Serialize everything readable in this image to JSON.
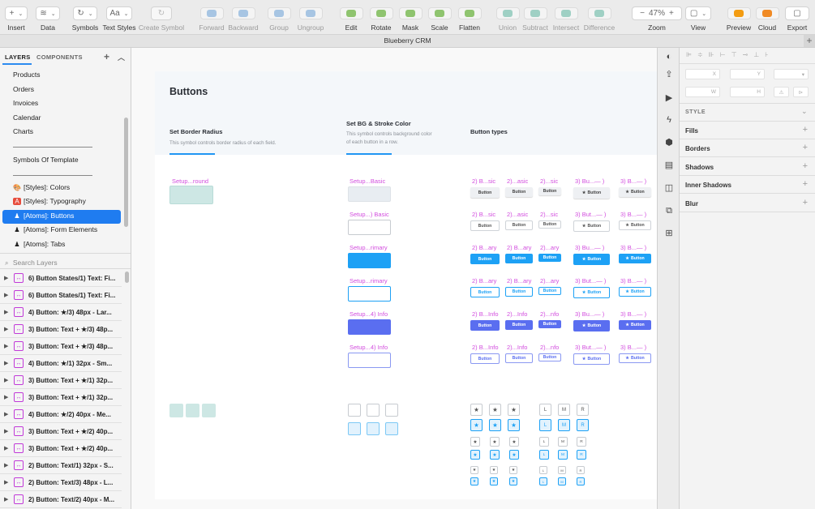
{
  "toolbar": {
    "items": [
      {
        "key": "insert",
        "label": "Insert",
        "icon": "plus-icon",
        "glyph": "+"
      },
      {
        "key": "data",
        "label": "Data",
        "icon": "layers-stack-icon",
        "glyph": "≋"
      },
      {
        "key": "symbols",
        "label": "Symbols",
        "icon": "symbol-icon",
        "glyph": "↻"
      },
      {
        "key": "text_styles",
        "label": "Text Styles",
        "icon": "text-icon",
        "glyph": "Aa"
      },
      {
        "key": "create_symbol",
        "label": "Create Symbol",
        "icon": "create-symbol-icon",
        "glyph": "↻"
      },
      {
        "key": "forward",
        "label": "Forward",
        "icon": "forward-icon"
      },
      {
        "key": "backward",
        "label": "Backward",
        "icon": "backward-icon"
      },
      {
        "key": "group",
        "label": "Group",
        "icon": "group-icon"
      },
      {
        "key": "ungroup",
        "label": "Ungroup",
        "icon": "ungroup-icon"
      },
      {
        "key": "edit",
        "label": "Edit",
        "icon": "edit-icon"
      },
      {
        "key": "rotate",
        "label": "Rotate",
        "icon": "rotate-icon"
      },
      {
        "key": "mask",
        "label": "Mask",
        "icon": "mask-icon"
      },
      {
        "key": "scale",
        "label": "Scale",
        "icon": "scale-icon"
      },
      {
        "key": "flatten",
        "label": "Flatten",
        "icon": "flatten-icon"
      },
      {
        "key": "union",
        "label": "Union",
        "icon": "union-icon"
      },
      {
        "key": "subtract",
        "label": "Subtract",
        "icon": "subtract-icon"
      },
      {
        "key": "intersect",
        "label": "Intersect",
        "icon": "intersect-icon"
      },
      {
        "key": "difference",
        "label": "Difference",
        "icon": "difference-icon"
      },
      {
        "key": "zoom",
        "label": "Zoom",
        "value": "47%"
      },
      {
        "key": "view",
        "label": "View",
        "icon": "view-icon"
      },
      {
        "key": "preview",
        "label": "Preview",
        "icon": "play-icon"
      },
      {
        "key": "cloud",
        "label": "Cloud",
        "icon": "cloud-icon"
      },
      {
        "key": "export",
        "label": "Export",
        "icon": "export-icon"
      }
    ]
  },
  "window": {
    "title": "Blueberry CRM"
  },
  "left_panel": {
    "tabs": {
      "layers": "LAYERS",
      "components": "COMPONENTS"
    },
    "pages": [
      "Products",
      "Orders",
      "Invoices",
      "Calendar",
      "Charts"
    ],
    "symbols_template": "Symbols Of Template",
    "style_pages": [
      {
        "label": "[Styles]: Colors",
        "icon": "palette-icon"
      },
      {
        "label": "[Styles]: Typography",
        "icon": "typography-icon"
      },
      {
        "label": "[Atoms]: Buttons",
        "icon": "joystick-icon",
        "selected": true
      },
      {
        "label": "[Atoms]: Form Elements",
        "icon": "joystick-icon"
      },
      {
        "label": "[Atoms]: Tabs",
        "icon": "joystick-icon"
      }
    ],
    "search_placeholder": "Search Layers",
    "layers": [
      "6) Button States/1) Text: Fi...",
      "6) Button States/1) Text: Fi...",
      "4) Button: ★/3) 48px - Lar...",
      "3) Button: Text + ★/3) 48p...",
      "3) Button: Text + ★/3) 48p...",
      "4) Button: ★/1) 32px - Sm...",
      "3) Button: Text + ★/1) 32p...",
      "3) Button: Text + ★/1) 32p...",
      "4) Button: ★/2) 40px - Me...",
      "3) Button: Text + ★/2) 40p...",
      "3) Button: Text + ★/2) 40p...",
      "2) Button: Text/1) 32px - S...",
      "2) Button: Text/3) 48px - L...",
      "2) Button: Text/2) 40px - M..."
    ]
  },
  "artboard": {
    "title": "Buttons",
    "col1": {
      "heading": "Set Border Radius",
      "desc": "This symbol controls border radius of each field."
    },
    "col2": {
      "heading": "BG & Stroke Color",
      "desc": "This symbol controls background color of each button in a row.",
      "heading_prefix": "Set"
    },
    "col3": {
      "heading": "Button types"
    },
    "radius_label": "Setup...round",
    "color_rows": [
      {
        "label": "Setup...Basic",
        "style": "basic"
      },
      {
        "label": "Setup...) Basic",
        "style": "outline"
      },
      {
        "label": "Setup...rimary",
        "style": "primary"
      },
      {
        "label": "Setup...rimary",
        "style": "poutline"
      },
      {
        "label": "Setup...4) Info",
        "style": "info"
      },
      {
        "label": "Setup...4) Info",
        "style": "ioutline"
      }
    ],
    "type_rows": [
      {
        "style": "basic",
        "labels": [
          "2) B...sic",
          "2)...asic",
          "2)...sic",
          "3) Bu...— )",
          "3) B...— )"
        ]
      },
      {
        "style": "outline",
        "labels": [
          "2) B...sic",
          "2)...asic",
          "2)...sic",
          "3) But...— )",
          "3) B...— )"
        ]
      },
      {
        "style": "primary",
        "labels": [
          "2) B...ary",
          "2) B...ary",
          "2)...ary",
          "3) Bu...— )",
          "3) B...— )"
        ]
      },
      {
        "style": "poutline",
        "labels": [
          "2) B...ary",
          "2) B...ary",
          "2)...ary",
          "3) But...— )",
          "3) B...— )"
        ]
      },
      {
        "style": "info",
        "labels": [
          "2) B...Info",
          "2)...Info",
          "2)...nfo",
          "3) Bu...— )",
          "3) B...— )"
        ]
      },
      {
        "style": "ioutline",
        "labels": [
          "2) B...Info",
          "2)...Info",
          "2)...nfo",
          "3) But...— )",
          "3) B...— )"
        ]
      }
    ],
    "button_text": "Button",
    "star": "★",
    "size_letters": [
      "L",
      "M",
      "R"
    ]
  },
  "inspector": {
    "fields": {
      "x": "X",
      "y": "Y",
      "w": "W",
      "h": "H"
    },
    "style_title": "STYLE",
    "sections": [
      "Fills",
      "Borders",
      "Shadows",
      "Inner Shadows",
      "Blur"
    ]
  },
  "colors": {
    "accent": "#1f7cf0",
    "primary": "#1da1f5",
    "info": "#5a6ef0",
    "symbol": "#c13ad8",
    "label": "#d24dde"
  }
}
